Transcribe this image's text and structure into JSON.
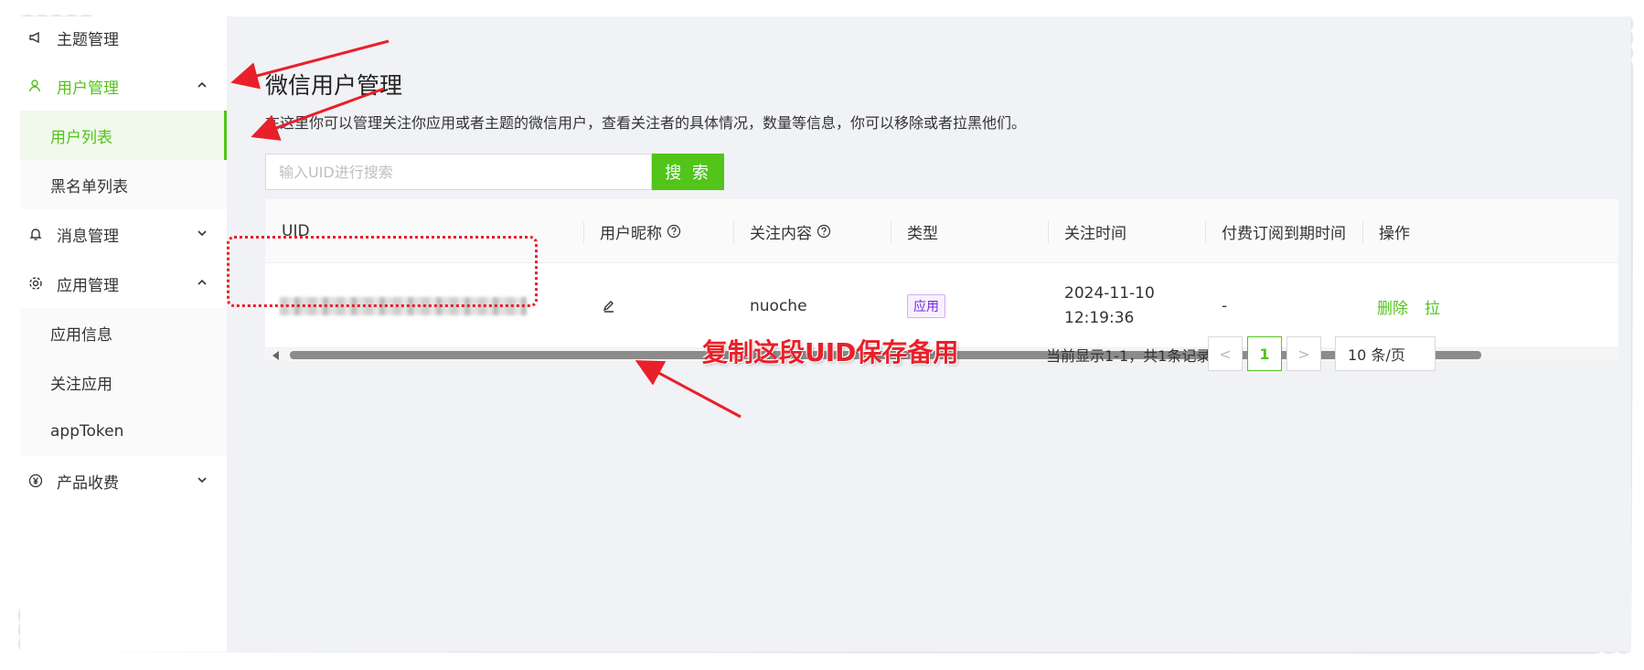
{
  "sidebar": {
    "items": [
      {
        "label": "主题管理",
        "icon": "megaphone-icon"
      },
      {
        "label": "用户管理",
        "icon": "user-icon",
        "expanded": true
      },
      {
        "label": "用户列表",
        "active": true
      },
      {
        "label": "黑名单列表"
      },
      {
        "label": "消息管理",
        "icon": "bell-icon",
        "expanded": false
      },
      {
        "label": "应用管理",
        "icon": "gear-icon",
        "expanded": true
      },
      {
        "label": "应用信息"
      },
      {
        "label": "关注应用"
      },
      {
        "label": "appToken"
      },
      {
        "label": "产品收费",
        "icon": "yen-icon",
        "expanded": false
      }
    ]
  },
  "main": {
    "title": "微信用户管理",
    "description": "在这里你可以管理关注你应用或者主题的微信用户，查看关注者的具体情况，数量等信息，你可以移除或者拉黑他们。",
    "search": {
      "placeholder": "输入UID进行搜索",
      "button_label": "搜 索"
    },
    "table": {
      "columns": [
        "UID",
        "用户昵称",
        "关注内容",
        "类型",
        "关注时间",
        "付费订阅到期时间",
        "操作"
      ],
      "rows": [
        {
          "uid": "",
          "nickname": "",
          "content": "nuoche",
          "type": "应用",
          "time_date": "2024-11-10",
          "time_clock": "12:19:36",
          "expiry": "-",
          "actions": [
            "删除",
            "拉"
          ]
        }
      ]
    },
    "pagination": {
      "info": "当前显示1-1，共1条记录",
      "prev": "<",
      "current": "1",
      "next": ">",
      "page_size": "10 条/页"
    }
  },
  "annotation": {
    "text": "复制这段UID保存备用",
    "color": "#e8202a"
  },
  "colors": {
    "accent": "#52c41a",
    "annotation": "#e8202a",
    "tag": "#722ed1"
  }
}
